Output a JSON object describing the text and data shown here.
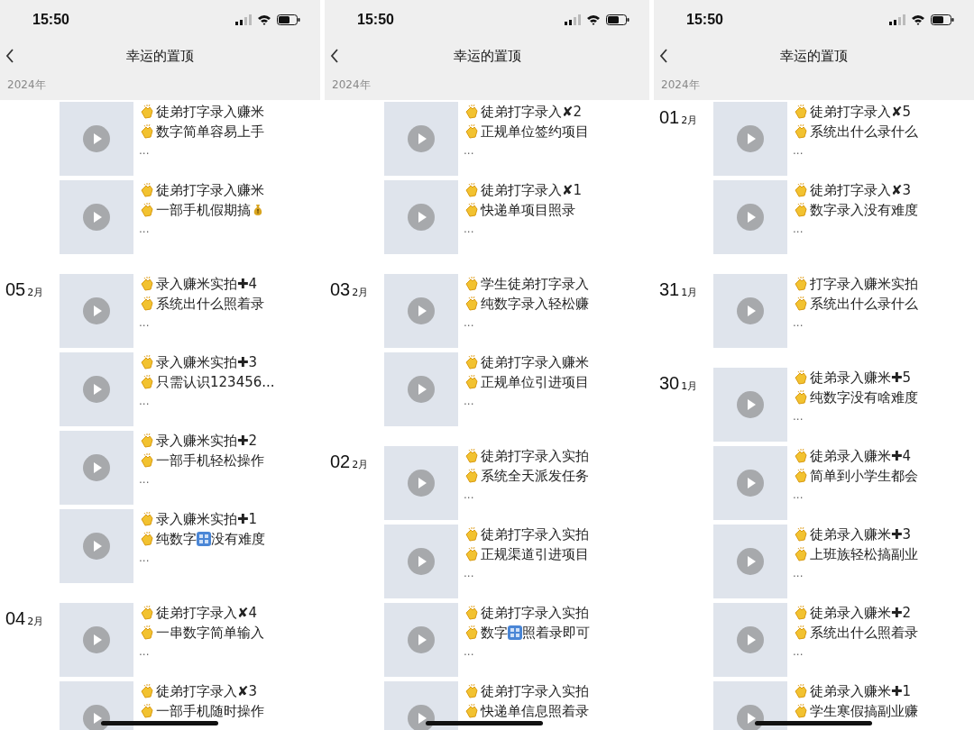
{
  "phones": [
    {
      "status_bar": {
        "time": "15:50"
      },
      "nav": {
        "title": "幸运的置顶"
      },
      "year": "2024年",
      "groups": [
        {
          "posts": [
            {
              "lines": [
                [
                  {
                    "kind": "text",
                    "text": "徒弟打字录入赚米"
                  }
                ],
                [
                  {
                    "kind": "text",
                    "text": "数字简单容易上手"
                  }
                ]
              ],
              "more": "..."
            },
            {
              "lines": [
                [
                  {
                    "kind": "text",
                    "text": "徒弟打字录入赚米"
                  }
                ],
                [
                  {
                    "kind": "text",
                    "text": "一部手机假期搞"
                  },
                  {
                    "kind": "money-bag"
                  }
                ]
              ],
              "more": "..."
            }
          ]
        },
        {
          "day": "05",
          "month": "2月",
          "posts": [
            {
              "lines": [
                [
                  {
                    "kind": "text",
                    "text": "录入赚米实拍✚4"
                  }
                ],
                [
                  {
                    "kind": "text",
                    "text": "系统出什么照着录"
                  }
                ]
              ],
              "more": "..."
            },
            {
              "lines": [
                [
                  {
                    "kind": "text",
                    "text": "录入赚米实拍✚3"
                  }
                ],
                [
                  {
                    "kind": "text",
                    "text": "只需认识123456..."
                  }
                ]
              ],
              "more": "..."
            },
            {
              "lines": [
                [
                  {
                    "kind": "text",
                    "text": "录入赚米实拍✚2"
                  }
                ],
                [
                  {
                    "kind": "text",
                    "text": "一部手机轻松操作"
                  }
                ]
              ],
              "more": "..."
            },
            {
              "lines": [
                [
                  {
                    "kind": "text",
                    "text": "录入赚米实拍✚1"
                  }
                ],
                [
                  {
                    "kind": "text",
                    "text": "纯数字"
                  },
                  {
                    "kind": "numbers"
                  },
                  {
                    "kind": "text",
                    "text": "没有难度"
                  }
                ]
              ],
              "more": "..."
            }
          ]
        },
        {
          "day": "04",
          "month": "2月",
          "posts": [
            {
              "lines": [
                [
                  {
                    "kind": "text",
                    "text": "徒弟打字录入✘4"
                  }
                ],
                [
                  {
                    "kind": "text",
                    "text": "一串数字简单输入"
                  }
                ]
              ],
              "more": "..."
            },
            {
              "lines": [
                [
                  {
                    "kind": "text",
                    "text": "徒弟打字录入✘3"
                  }
                ],
                [
                  {
                    "kind": "text",
                    "text": "一部手机随时操作"
                  }
                ]
              ]
            }
          ]
        }
      ]
    },
    {
      "status_bar": {
        "time": "15:50"
      },
      "nav": {
        "title": "幸运的置顶"
      },
      "year": "2024年",
      "groups": [
        {
          "posts": [
            {
              "lines": [
                [
                  {
                    "kind": "text",
                    "text": "徒弟打字录入✘2"
                  }
                ],
                [
                  {
                    "kind": "text",
                    "text": "正规单位签约项目"
                  }
                ]
              ],
              "more": "..."
            },
            {
              "lines": [
                [
                  {
                    "kind": "text",
                    "text": "徒弟打字录入✘1"
                  }
                ],
                [
                  {
                    "kind": "text",
                    "text": "快递单项目照录"
                  }
                ]
              ],
              "more": "..."
            }
          ]
        },
        {
          "day": "03",
          "month": "2月",
          "posts": [
            {
              "lines": [
                [
                  {
                    "kind": "text",
                    "text": "学生徒弟打字录入"
                  }
                ],
                [
                  {
                    "kind": "text",
                    "text": "纯数字录入轻松赚"
                  }
                ]
              ],
              "more": "..."
            },
            {
              "lines": [
                [
                  {
                    "kind": "text",
                    "text": "徒弟打字录入赚米"
                  }
                ],
                [
                  {
                    "kind": "text",
                    "text": "正规单位引进项目"
                  }
                ]
              ],
              "more": "..."
            }
          ]
        },
        {
          "day": "02",
          "month": "2月",
          "posts": [
            {
              "lines": [
                [
                  {
                    "kind": "text",
                    "text": "徒弟打字录入实拍"
                  }
                ],
                [
                  {
                    "kind": "text",
                    "text": "系统全天派发任务"
                  }
                ]
              ],
              "more": "..."
            },
            {
              "lines": [
                [
                  {
                    "kind": "text",
                    "text": "徒弟打字录入实拍"
                  }
                ],
                [
                  {
                    "kind": "text",
                    "text": "正规渠道引进项目"
                  }
                ]
              ],
              "more": "..."
            },
            {
              "lines": [
                [
                  {
                    "kind": "text",
                    "text": "徒弟打字录入实拍"
                  }
                ],
                [
                  {
                    "kind": "text",
                    "text": "数字"
                  },
                  {
                    "kind": "numbers"
                  },
                  {
                    "kind": "text",
                    "text": "照着录即可"
                  }
                ]
              ],
              "more": "..."
            },
            {
              "lines": [
                [
                  {
                    "kind": "text",
                    "text": "徒弟打字录入实拍"
                  }
                ],
                [
                  {
                    "kind": "text",
                    "text": "快递单信息照着录"
                  }
                ]
              ]
            }
          ]
        }
      ]
    },
    {
      "status_bar": {
        "time": "15:50"
      },
      "nav": {
        "title": "幸运的置顶"
      },
      "year": "2024年",
      "groups": [
        {
          "day": "01",
          "month": "2月",
          "posts": [
            {
              "lines": [
                [
                  {
                    "kind": "text",
                    "text": "徒弟打字录入✘5"
                  }
                ],
                [
                  {
                    "kind": "text",
                    "text": "系统出什么录什么"
                  }
                ]
              ],
              "more": "..."
            },
            {
              "lines": [
                [
                  {
                    "kind": "text",
                    "text": "徒弟打字录入✘3"
                  }
                ],
                [
                  {
                    "kind": "text",
                    "text": "数字录入没有难度"
                  }
                ]
              ],
              "more": "..."
            }
          ]
        },
        {
          "day": "31",
          "month": "1月",
          "posts": [
            {
              "lines": [
                [
                  {
                    "kind": "text",
                    "text": "打字录入赚米实拍"
                  }
                ],
                [
                  {
                    "kind": "text",
                    "text": "系统出什么录什么"
                  }
                ]
              ],
              "more": "..."
            }
          ]
        },
        {
          "day": "30",
          "month": "1月",
          "posts": [
            {
              "lines": [
                [
                  {
                    "kind": "text",
                    "text": "徒弟录入赚米✚5"
                  }
                ],
                [
                  {
                    "kind": "text",
                    "text": "纯数字没有啥难度"
                  }
                ]
              ],
              "more": "..."
            },
            {
              "lines": [
                [
                  {
                    "kind": "text",
                    "text": "徒弟录入赚米✚4"
                  }
                ],
                [
                  {
                    "kind": "text",
                    "text": "简单到小学生都会"
                  }
                ]
              ],
              "more": "..."
            },
            {
              "lines": [
                [
                  {
                    "kind": "text",
                    "text": "徒弟录入赚米✚3"
                  }
                ],
                [
                  {
                    "kind": "text",
                    "text": "上班族轻松搞副业"
                  }
                ]
              ],
              "more": "..."
            },
            {
              "lines": [
                [
                  {
                    "kind": "text",
                    "text": "徒弟录入赚米✚2"
                  }
                ],
                [
                  {
                    "kind": "text",
                    "text": "系统出什么照着录"
                  }
                ]
              ],
              "more": "..."
            },
            {
              "lines": [
                [
                  {
                    "kind": "text",
                    "text": "徒弟录入赚米✚1"
                  }
                ],
                [
                  {
                    "kind": "text",
                    "text": "学生寒假搞副业赚"
                  }
                ]
              ]
            }
          ]
        }
      ]
    }
  ]
}
